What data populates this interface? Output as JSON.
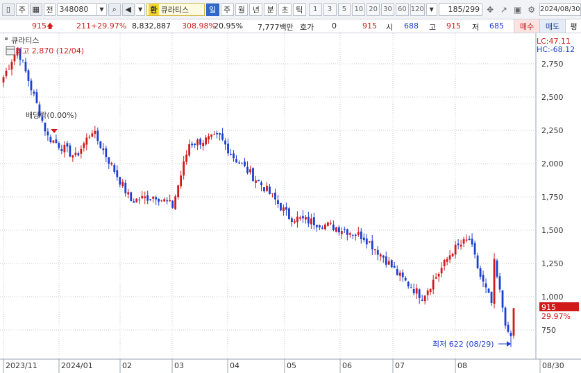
{
  "toolbar": {
    "freq_label": "주",
    "prev_label": "전",
    "code": "348080",
    "hwan_label": "환",
    "stock_name": "큐라티스",
    "periods": [
      "일",
      "주",
      "월",
      "년",
      "분",
      "초",
      "틱"
    ],
    "active_period": "일",
    "numbers": [
      "1",
      "3",
      "5",
      "10",
      "20",
      "30",
      "60",
      "120"
    ],
    "counter": "185/299",
    "date": "2024/08/30"
  },
  "quote": {
    "price": "915",
    "change": "211",
    "change_pct": "+29.97%",
    "volume": "8,832,887",
    "volume_ratio": "308.98%",
    "turnover": "20.95%",
    "amount": "7,777백만",
    "hoga_label": "호가",
    "hoga_value": "0",
    "hoga_price": "915",
    "open_label": "시",
    "open": "688",
    "high_label": "고",
    "high": "915",
    "low_label": "저",
    "low": "685",
    "buy_label": "매수",
    "sell_label": "매도",
    "eval_label": "평"
  },
  "chart": {
    "legend_name": "큐라티스",
    "lc_label": "LC:47.11",
    "hc_label": "HC:-68.12",
    "high_annotation": "최고 2,870 (12/04)",
    "low_annotation": "최저 622 (08/29)",
    "dividend_annotation": "배당락(0.00%)",
    "last_price_label": "915",
    "last_pct_label": "29.97%",
    "colors": {
      "up": "#d11b1b",
      "down": "#1d3fd0",
      "grid": "#c9c9c9"
    }
  },
  "chart_data": {
    "type": "candlestick",
    "ylim": [
      622,
      2870
    ],
    "y_ticks": [
      2750,
      2500,
      2250,
      2000,
      1750,
      1500,
      1250,
      1000,
      750
    ],
    "y_tick_labels": [
      "2,750",
      "2,500",
      "2,250",
      "2,000",
      "1,750",
      "1,500",
      "1,250",
      "1,000",
      "750"
    ],
    "x_ticks": [
      "2023/11",
      "2024/01",
      "02",
      "03",
      "04",
      "05",
      "06",
      "07",
      "08",
      "08/30"
    ],
    "ohlc_keypoints": [
      {
        "label": "start",
        "close": 2650
      },
      {
        "label": "12/04 high",
        "close": 2870
      },
      {
        "label": "dividend",
        "close": 2200
      },
      {
        "label": "dip",
        "close": 2050
      },
      {
        "label": "rebound",
        "close": 2250
      },
      {
        "label": "02 low",
        "close": 1720
      },
      {
        "label": "02 mid",
        "close": 1760
      },
      {
        "label": "03 low",
        "close": 1680
      },
      {
        "label": "03 high",
        "close": 2150
      },
      {
        "label": "03 end",
        "close": 2200
      },
      {
        "label": "04 start",
        "close": 2050
      },
      {
        "label": "04 mid",
        "close": 1800
      },
      {
        "label": "04 end",
        "close": 1600
      },
      {
        "label": "05 start",
        "close": 1560
      },
      {
        "label": "05 mid",
        "close": 1510
      },
      {
        "label": "05 end",
        "close": 1450
      },
      {
        "label": "06 start",
        "close": 1300
      },
      {
        "label": "06 mid",
        "close": 1150
      },
      {
        "label": "06 end",
        "close": 1000
      },
      {
        "label": "07 start",
        "close": 1180
      },
      {
        "label": "07 mid",
        "close": 1350
      },
      {
        "label": "07 end",
        "close": 1430
      },
      {
        "label": "08 start",
        "close": 1150
      },
      {
        "label": "08 dip",
        "close": 950
      },
      {
        "label": "08 bounce",
        "close": 1250
      },
      {
        "label": "08/29 low",
        "close": 704
      },
      {
        "label": "08/30",
        "close": 915
      }
    ]
  }
}
